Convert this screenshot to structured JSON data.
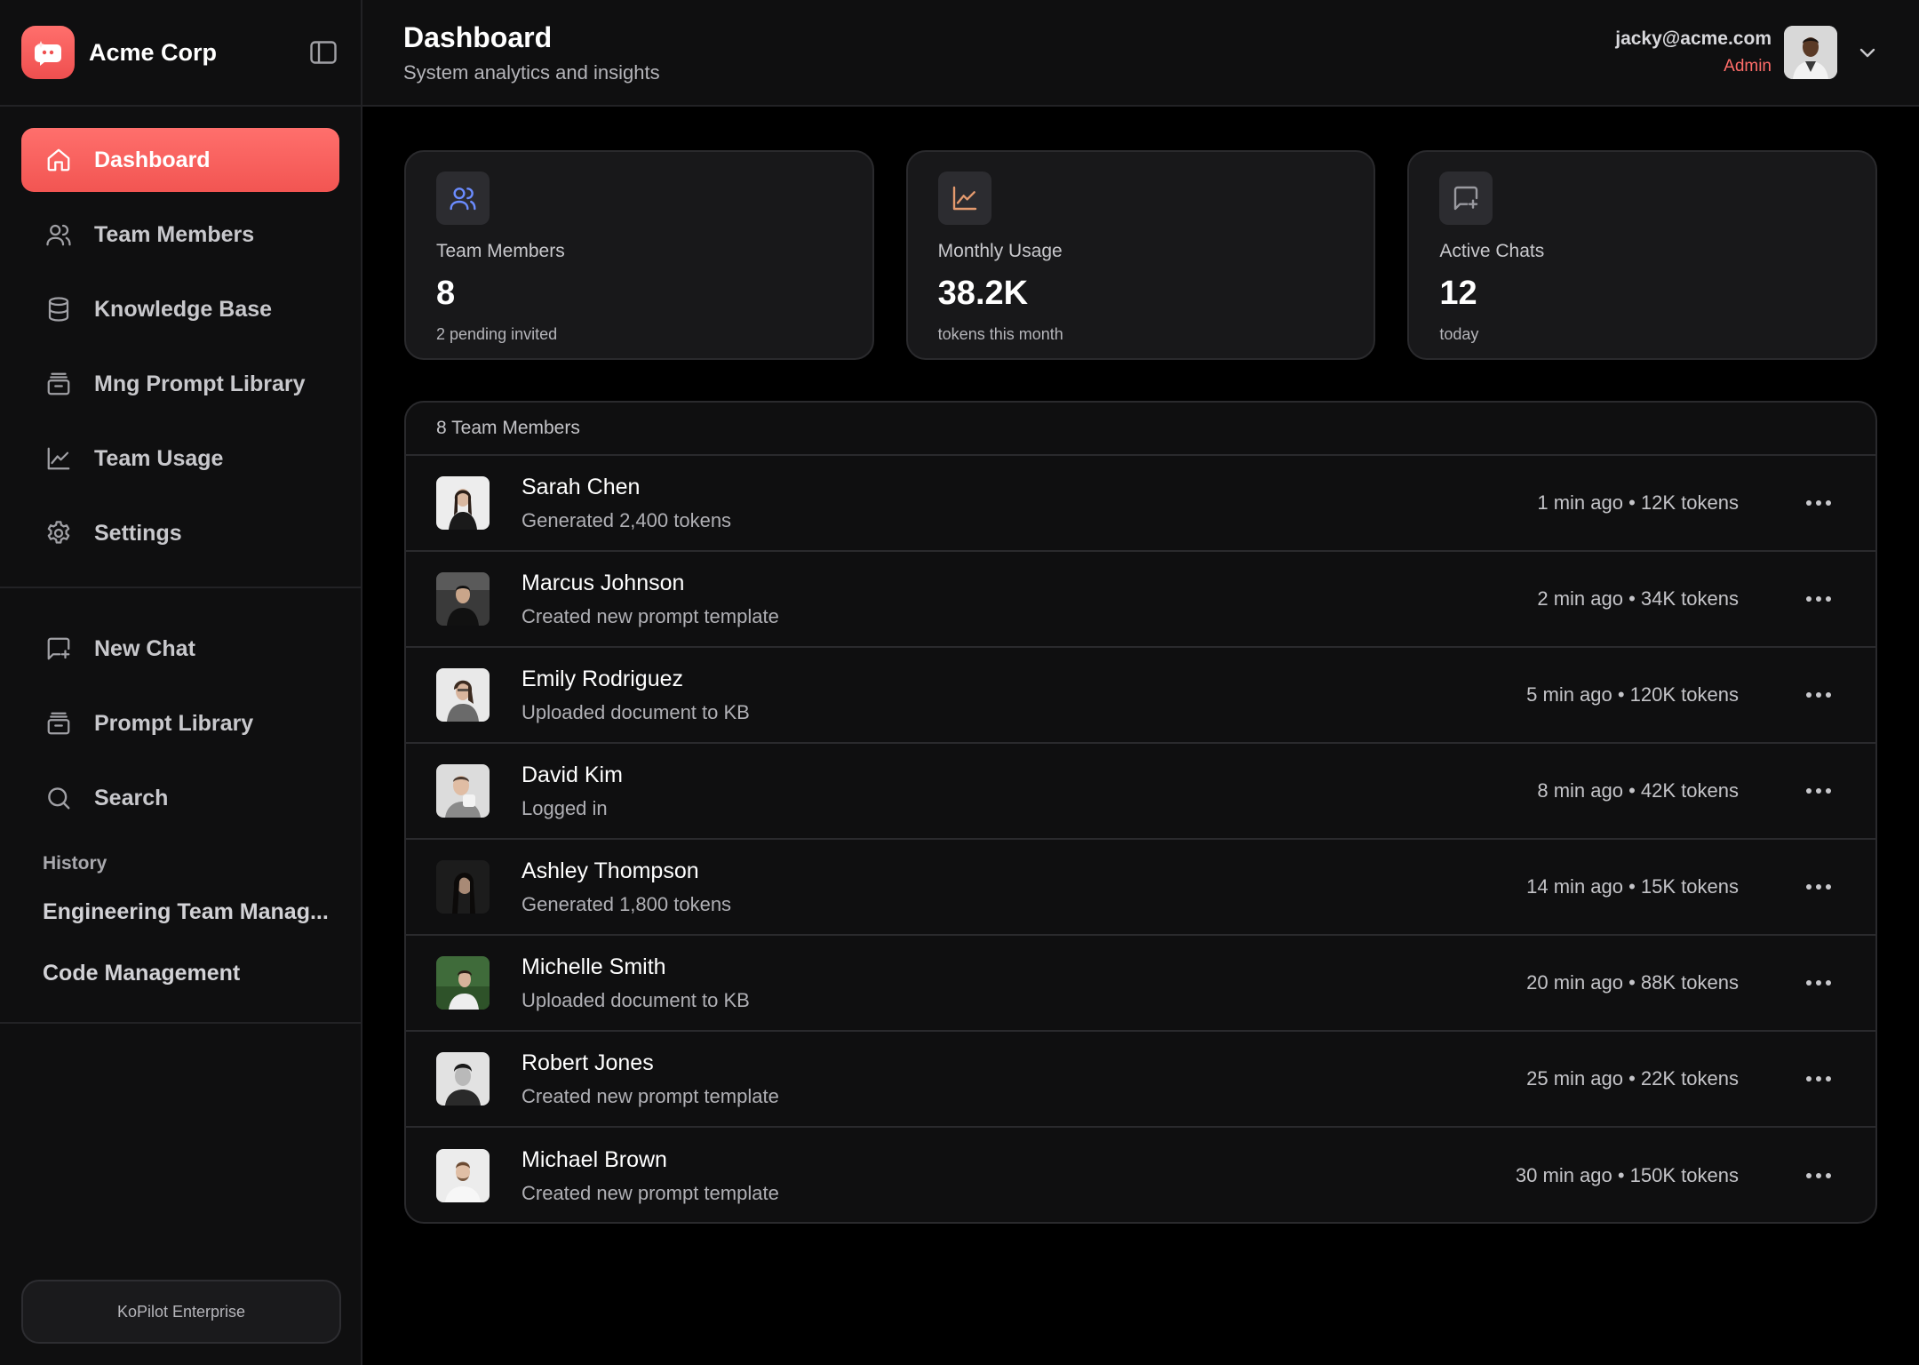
{
  "brand": {
    "name": "Acme Corp"
  },
  "colors": {
    "accent": "#f25552",
    "background": "#000000",
    "panel": "#0f0f10",
    "card": "#18181a",
    "role": "#ff6d69"
  },
  "sidebar": {
    "nav": [
      {
        "label": "Dashboard",
        "icon": "home-icon",
        "active": true
      },
      {
        "label": "Team Members",
        "icon": "users-icon"
      },
      {
        "label": "Knowledge Base",
        "icon": "database-icon"
      },
      {
        "label": "Mng Prompt Library",
        "icon": "archive-icon"
      },
      {
        "label": "Team Usage",
        "icon": "line-chart-icon"
      },
      {
        "label": "Settings",
        "icon": "gear-icon"
      }
    ],
    "secondary": [
      {
        "label": "New Chat",
        "icon": "message-plus-icon"
      },
      {
        "label": "Prompt Library",
        "icon": "archive-icon"
      },
      {
        "label": "Search",
        "icon": "search-icon"
      }
    ],
    "history": {
      "heading": "History",
      "items": [
        "Engineering Team Manag...",
        "Code Management"
      ]
    },
    "plan": "KoPilot Enterprise"
  },
  "header": {
    "title": "Dashboard",
    "subtitle": "System analytics and insights",
    "user": {
      "email": "jacky@acme.com",
      "role": "Admin"
    }
  },
  "stats": [
    {
      "label": "Team Members",
      "value": "8",
      "note": "2 pending invited",
      "icon": "users-icon"
    },
    {
      "label": "Monthly Usage",
      "value": "38.2K",
      "note": "tokens this month",
      "icon": "line-chart-icon"
    },
    {
      "label": "Active Chats",
      "value": "12",
      "note": "today",
      "icon": "message-plus-icon"
    }
  ],
  "members": {
    "heading": "8 Team Members",
    "rows": [
      {
        "name": "Sarah Chen",
        "activity": "Generated 2,400 tokens",
        "meta": "1 min ago • 12K tokens"
      },
      {
        "name": "Marcus Johnson",
        "activity": "Created new prompt template",
        "meta": "2 min ago • 34K tokens"
      },
      {
        "name": "Emily Rodriguez",
        "activity": "Uploaded document to KB",
        "meta": "5 min ago • 120K tokens"
      },
      {
        "name": "David Kim",
        "activity": "Logged in",
        "meta": "8 min ago • 42K tokens"
      },
      {
        "name": "Ashley Thompson",
        "activity": "Generated 1,800 tokens",
        "meta": "14 min ago • 15K tokens"
      },
      {
        "name": "Michelle Smith",
        "activity": "Uploaded document to KB",
        "meta": "20 min ago • 88K tokens"
      },
      {
        "name": "Robert Jones",
        "activity": "Created new prompt template",
        "meta": "25 min ago • 22K tokens"
      },
      {
        "name": "Michael Brown",
        "activity": "Created new prompt template",
        "meta": "30 min ago • 150K tokens"
      }
    ]
  }
}
